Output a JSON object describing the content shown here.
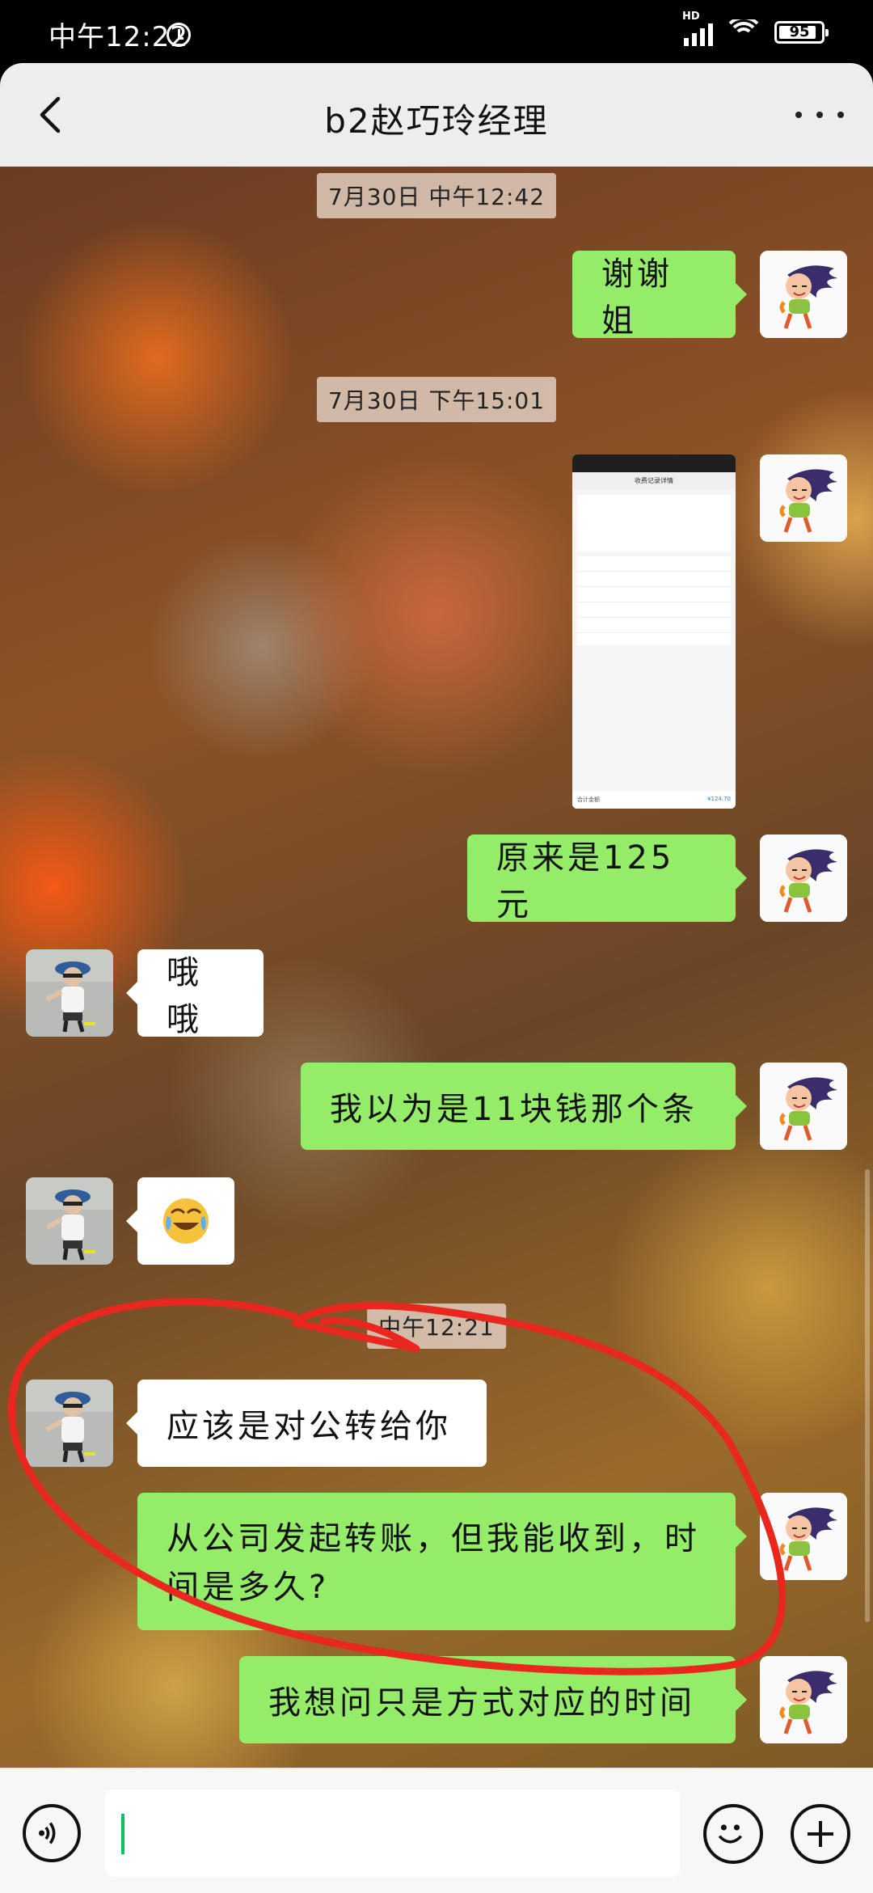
{
  "status_bar": {
    "time": "中午12:22",
    "network": "HD",
    "battery": "95"
  },
  "header": {
    "title": "b2赵巧玲经理"
  },
  "messages": {
    "timestamp1": "7月30日 中午12:42",
    "msg1": "谢谢姐",
    "timestamp2": "7月30日 下午15:01",
    "msg2_image": {
      "title": "收费记录详情",
      "total_label": "合计金额",
      "total_value": "¥124.70"
    },
    "msg3": "原来是125元",
    "msg4": "哦哦",
    "msg5": "我以为是11块钱那个条",
    "msg6_emoji": "laughing-crying-emoji",
    "timestamp3": "中午12:21",
    "msg7": "应该是对公转给你",
    "msg8": "从公司发起转账，但我能收到，时间是多久?",
    "msg9": "我想问只是方式对应的时间"
  },
  "colors": {
    "my_bubble": "#95ec69",
    "their_bubble": "#ffffff",
    "annotation": "#e8281e"
  }
}
